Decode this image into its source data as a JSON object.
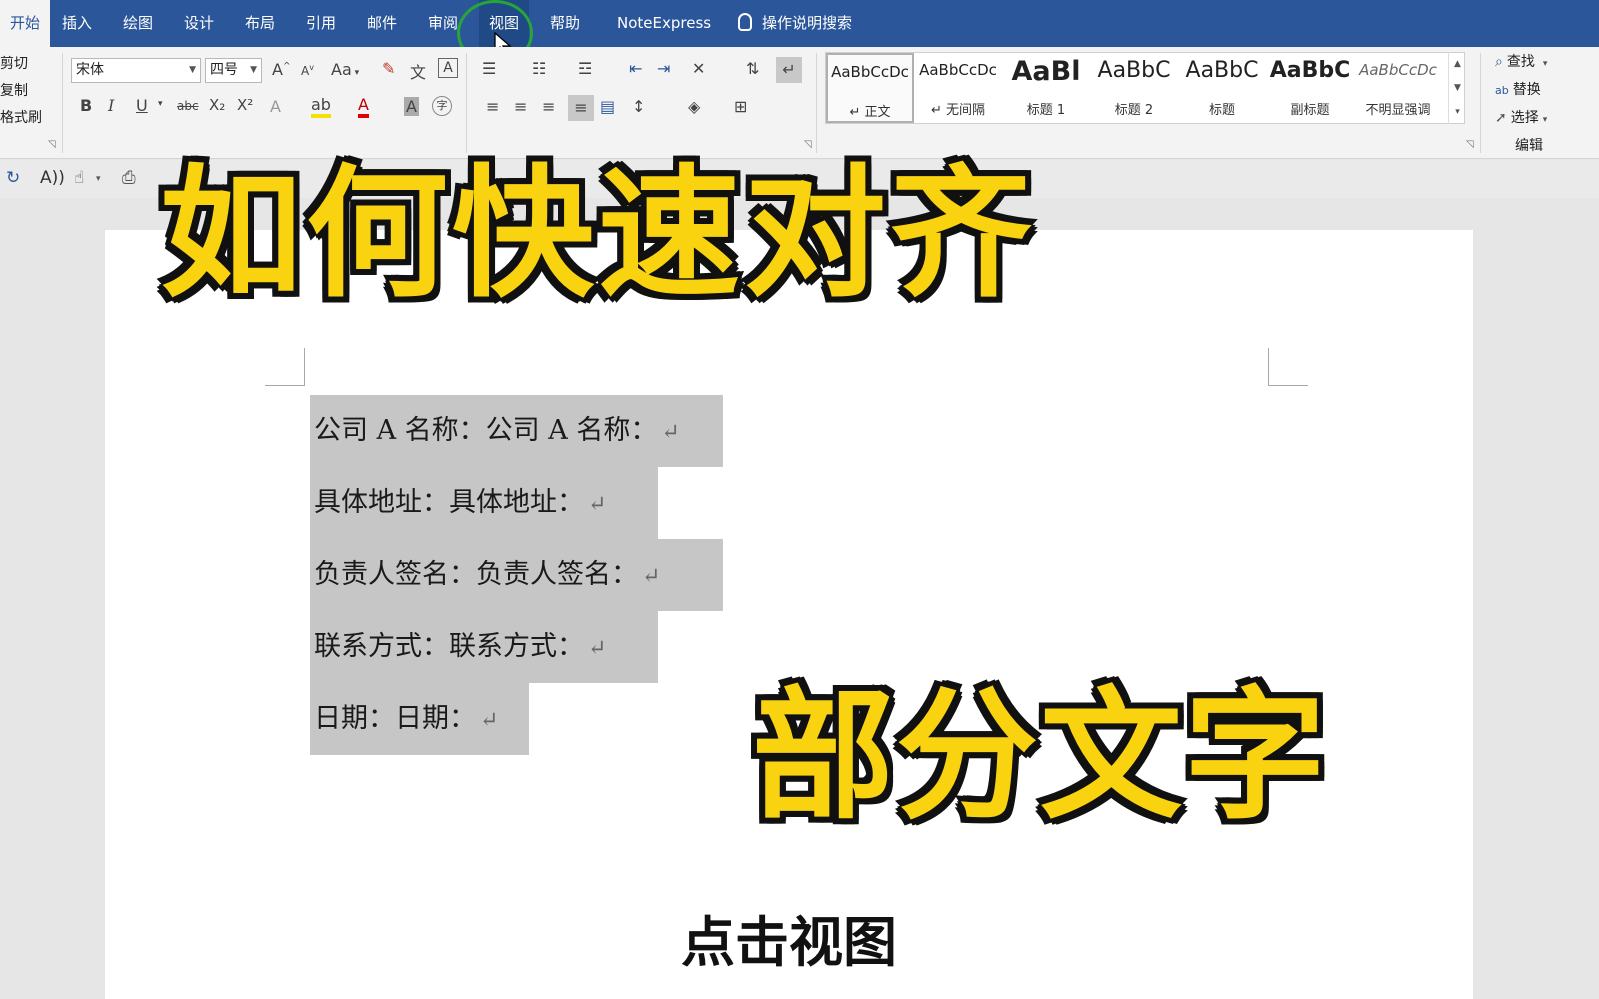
{
  "ribbon_tabs": [
    "开始",
    "插入",
    "绘图",
    "设计",
    "布局",
    "引用",
    "邮件",
    "审阅",
    "视图",
    "帮助",
    "NoteExpress"
  ],
  "tell_me": "操作说明搜索",
  "clipboard": {
    "cut": "剪切",
    "copy": "复制",
    "format_painter": "格式刷"
  },
  "font": {
    "family": "宋体",
    "size": "四号",
    "row1": [
      "A",
      "A",
      "Aa"
    ],
    "row2": [
      "B",
      "I",
      "U",
      "abc",
      "X₂",
      "X²"
    ],
    "font_color_letter": "A",
    "shade_letter": "A",
    "enclose": "字"
  },
  "styles": [
    {
      "sample": "AaBbCcDc",
      "name": "↵ 正文"
    },
    {
      "sample": "AaBbCcDc",
      "name": "↵ 无间隔"
    },
    {
      "sample": "AaBl",
      "name": "标题 1"
    },
    {
      "sample": "AaBbC",
      "name": "标题 2"
    },
    {
      "sample": "AaBbC",
      "name": "标题"
    },
    {
      "sample": "AaBbC",
      "name": "副标题"
    },
    {
      "sample": "AaBbCcDc",
      "name": "不明显强调"
    }
  ],
  "editing": {
    "find": "查找",
    "replace": "替换",
    "select": "选择",
    "group_label": "编辑"
  },
  "document": {
    "lines": [
      "公司 A 名称：公司 A 名称：",
      "具体地址：具体地址：",
      "负责人签名：负责人签名：",
      "联系方式：联系方式：",
      "日期：日期："
    ],
    "paragraph_mark": "↵"
  },
  "overlay": {
    "title_top": "如何快速对齐",
    "title_bottom": "部分文字",
    "subtitle": "点击视图"
  },
  "colors": {
    "ribbon_blue": "#2b579a",
    "caption_yellow": "#f9d30f",
    "selection_gray": "#c6c6c6",
    "focus_ring": "#27a53a"
  }
}
